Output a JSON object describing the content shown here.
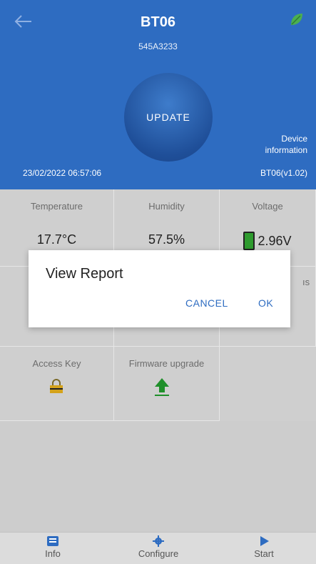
{
  "header": {
    "title": "BT06",
    "serial": "545A3233",
    "update_label": "UPDATE",
    "timestamp": "23/02/2022  06:57:06",
    "device_info_label": "Device information",
    "version": "BT06(v1.02)"
  },
  "cards": {
    "temperature": {
      "label": "Temperature",
      "value": "17.7°C"
    },
    "humidity": {
      "label": "Humidity",
      "value": "57.5%"
    },
    "voltage": {
      "label": "Voltage",
      "value": "2.96V"
    },
    "access_key": {
      "label": "Access Key"
    },
    "firmware": {
      "label": "Firmware upgrade"
    },
    "truncated_text": "ıs"
  },
  "dialog": {
    "title": "View Report",
    "cancel": "CANCEL",
    "ok": "OK"
  },
  "bottom_nav": [
    {
      "label": "Info",
      "icon": "info-icon"
    },
    {
      "label": "Configure",
      "icon": "gear-icon"
    },
    {
      "label": "Start",
      "icon": "play-icon"
    }
  ],
  "colors": {
    "primary": "#2e6cc1",
    "battery": "#2e9b2e",
    "lock": "#d4a21a",
    "upgrade": "#1f8f2a"
  }
}
